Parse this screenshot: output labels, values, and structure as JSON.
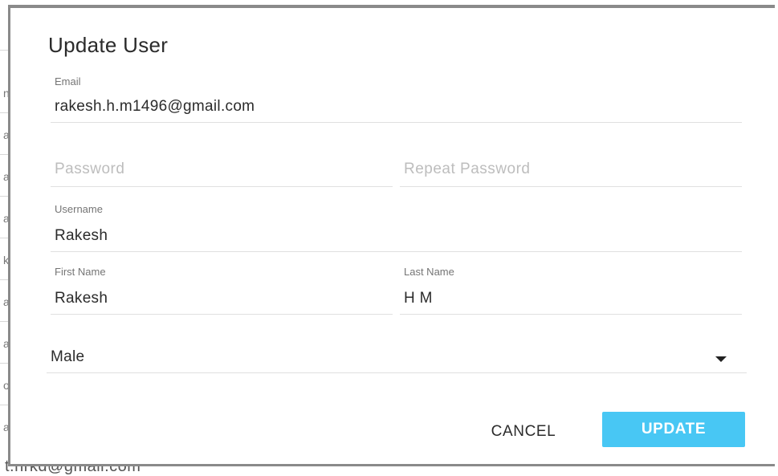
{
  "dialog": {
    "title": "Update User"
  },
  "form": {
    "email": {
      "label": "Email",
      "value": "rakesh.h.m1496@gmail.com"
    },
    "password": {
      "placeholder": "Password"
    },
    "repeat_password": {
      "placeholder": "Repeat Password"
    },
    "username": {
      "label": "Username",
      "value": "Rakesh"
    },
    "first_name": {
      "label": "First Name",
      "value": "Rakesh"
    },
    "last_name": {
      "label": "Last Name",
      "value": "H M"
    },
    "gender": {
      "selected": "Male",
      "icon": "dropdown-arrow-icon"
    }
  },
  "actions": {
    "cancel_label": "CANCEL",
    "update_label": "UPDATE"
  },
  "background": {
    "partial_email": "t.nrkd@gmail.com"
  },
  "colors": {
    "accent": "#48c7f4",
    "underline": "#e0e0e0",
    "label": "#757575",
    "placeholder": "#bdbdbd"
  }
}
